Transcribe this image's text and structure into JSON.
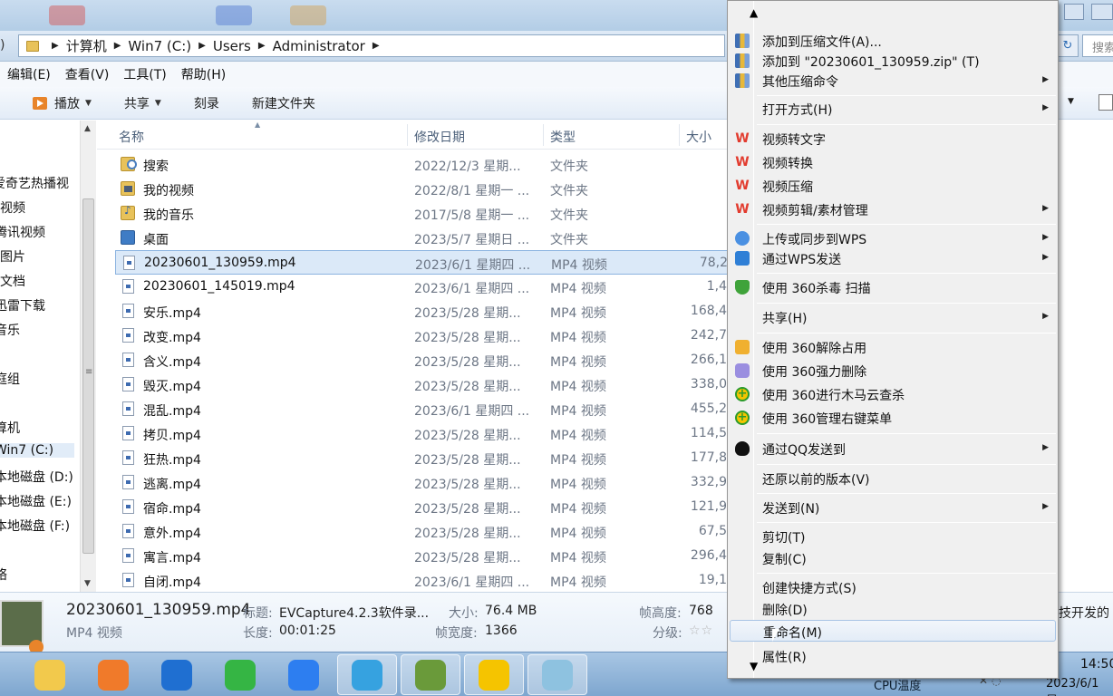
{
  "address": {
    "crumbs": [
      "计算机",
      "Win7 (C:)",
      "Users",
      "Administrator"
    ],
    "search_placeholder": "搜索"
  },
  "menubar": [
    "编辑(E)",
    "查看(V)",
    "工具(T)",
    "帮助(H)"
  ],
  "toolbar": {
    "play": "播放",
    "share": "共享",
    "burn": "刻录",
    "new_folder": "新建文件夹"
  },
  "nav": {
    "items": [
      "爱奇艺热播视",
      "视频",
      "腾讯视频",
      "图片",
      "文档",
      "迅雷下载",
      "音乐",
      "庭组",
      "算机",
      "Win7 (C:)",
      "本地磁盘 (D:)",
      "本地磁盘 (E:)",
      "本地磁盘 (F:)",
      "络"
    ]
  },
  "columns": {
    "name": "名称",
    "date": "修改日期",
    "type": "类型",
    "size": "大小"
  },
  "files": [
    {
      "name": "搜索",
      "date": "2022/12/3 星期...",
      "type": "文件夹",
      "size": "",
      "icon": "folder-search-icon"
    },
    {
      "name": "我的视频",
      "date": "2022/8/1 星期一 ...",
      "type": "文件夹",
      "size": "",
      "icon": "folder-video-icon"
    },
    {
      "name": "我的音乐",
      "date": "2017/5/8 星期一 ...",
      "type": "文件夹",
      "size": "",
      "icon": "folder-music-icon"
    },
    {
      "name": "桌面",
      "date": "2023/5/7 星期日 ...",
      "type": "文件夹",
      "size": "",
      "icon": "desktop-folder-icon"
    },
    {
      "name": "20230601_130959.mp4",
      "date": "2023/6/1 星期四 ...",
      "type": "MP4 视频",
      "size": "78,2",
      "icon": "video-file-icon"
    },
    {
      "name": "20230601_145019.mp4",
      "date": "2023/6/1 星期四 ...",
      "type": "MP4 视频",
      "size": "1,4",
      "icon": "video-file-icon"
    },
    {
      "name": "安乐.mp4",
      "date": "2023/5/28 星期...",
      "type": "MP4 视频",
      "size": "168,4",
      "icon": "video-file-icon"
    },
    {
      "name": "改变.mp4",
      "date": "2023/5/28 星期...",
      "type": "MP4 视频",
      "size": "242,7",
      "icon": "video-file-icon"
    },
    {
      "name": "含义.mp4",
      "date": "2023/5/28 星期...",
      "type": "MP4 视频",
      "size": "266,1",
      "icon": "video-file-icon"
    },
    {
      "name": "毁灭.mp4",
      "date": "2023/5/28 星期...",
      "type": "MP4 视频",
      "size": "338,0",
      "icon": "video-file-icon"
    },
    {
      "name": "混乱.mp4",
      "date": "2023/6/1 星期四 ...",
      "type": "MP4 视频",
      "size": "455,2",
      "icon": "video-file-icon"
    },
    {
      "name": "拷贝.mp4",
      "date": "2023/5/28 星期...",
      "type": "MP4 视频",
      "size": "114,5",
      "icon": "video-file-icon"
    },
    {
      "name": "狂热.mp4",
      "date": "2023/5/28 星期...",
      "type": "MP4 视频",
      "size": "177,8",
      "icon": "video-file-icon"
    },
    {
      "name": "逃离.mp4",
      "date": "2023/5/28 星期...",
      "type": "MP4 视频",
      "size": "332,9",
      "icon": "video-file-icon"
    },
    {
      "name": "宿命.mp4",
      "date": "2023/5/28 星期...",
      "type": "MP4 视频",
      "size": "121,9",
      "icon": "video-file-icon"
    },
    {
      "name": "意外.mp4",
      "date": "2023/5/28 星期...",
      "type": "MP4 视频",
      "size": "67,5",
      "icon": "video-file-icon"
    },
    {
      "name": "寓言.mp4",
      "date": "2023/5/28 星期...",
      "type": "MP4 视频",
      "size": "296,4",
      "icon": "video-file-icon"
    },
    {
      "name": "自闭.mp4",
      "date": "2023/6/1 星期四 ...",
      "type": "MP4 视频",
      "size": "19,1",
      "icon": "video-file-icon"
    }
  ],
  "details": {
    "filename": "20230601_130959.mp4",
    "filetype": "MP4 视频",
    "title_label": "标题:",
    "title_value": "EVCapture4.2.3软件录...",
    "size_label": "大小:",
    "size_value": "76.4 MB",
    "height_label": "帧高度:",
    "height_value": "768",
    "length_label": "长度:",
    "length_value": "00:01:25",
    "width_label": "帧宽度:",
    "width_value": "1366",
    "rating_label": "分级:",
    "rating_stars": "☆☆",
    "extra": "技开发的"
  },
  "context_menu": {
    "items": [
      {
        "label": "添加到压缩文件(A)...",
        "icon": "archive-icon",
        "submenu": false
      },
      {
        "label": "添加到 \"20230601_130959.zip\" (T)",
        "icon": "archive-icon",
        "submenu": false
      },
      {
        "label": "其他压缩命令",
        "icon": "archive-icon",
        "submenu": true
      },
      {
        "label": "打开方式(H)",
        "icon": "",
        "submenu": true
      },
      {
        "label": "视频转文字",
        "icon": "wps-icon",
        "submenu": false
      },
      {
        "label": "视频转换",
        "icon": "wps-icon",
        "submenu": false
      },
      {
        "label": "视频压缩",
        "icon": "wps-icon",
        "submenu": false
      },
      {
        "label": "视频剪辑/素材管理",
        "icon": "wps-icon",
        "submenu": true
      },
      {
        "label": "上传或同步到WPS",
        "icon": "cloud-upload-icon",
        "submenu": true
      },
      {
        "label": "通过WPS发送",
        "icon": "send-icon",
        "submenu": true
      },
      {
        "label": "使用 360杀毒 扫描",
        "icon": "shield-icon",
        "submenu": false
      },
      {
        "label": "共享(H)",
        "icon": "",
        "submenu": true
      },
      {
        "label": "使用 360解除占用",
        "icon": "unlock-icon",
        "submenu": false
      },
      {
        "label": "使用 360强力删除",
        "icon": "shred-icon",
        "submenu": false
      },
      {
        "label": "使用 360进行木马云查杀",
        "icon": "plus-360-icon",
        "submenu": false
      },
      {
        "label": "使用 360管理右键菜单",
        "icon": "plus-360-icon",
        "submenu": false
      },
      {
        "label": "通过QQ发送到",
        "icon": "qq-icon",
        "submenu": true
      },
      {
        "label": "还原以前的版本(V)",
        "icon": "",
        "submenu": false
      },
      {
        "label": "发送到(N)",
        "icon": "",
        "submenu": true
      },
      {
        "label": "剪切(T)",
        "icon": "",
        "submenu": false
      },
      {
        "label": "复制(C)",
        "icon": "",
        "submenu": false
      },
      {
        "label": "创建快捷方式(S)",
        "icon": "",
        "submenu": false
      },
      {
        "label": "删除(D)",
        "icon": "",
        "submenu": false
      },
      {
        "label": "重命名(M)",
        "icon": "",
        "submenu": false
      },
      {
        "label": "属性(R)",
        "icon": "",
        "submenu": false
      }
    ]
  },
  "taskbar": {
    "apps": [
      "explorer-icon",
      "uc-browser-icon",
      "kugou-icon",
      "wechat-icon",
      "feishu-icon",
      "ie-icon",
      "minecraft-icon",
      "360-icon",
      "notepad-icon"
    ],
    "cpu_label": "CPU温度",
    "time": "14:50",
    "date": "2023/6/1 星"
  }
}
